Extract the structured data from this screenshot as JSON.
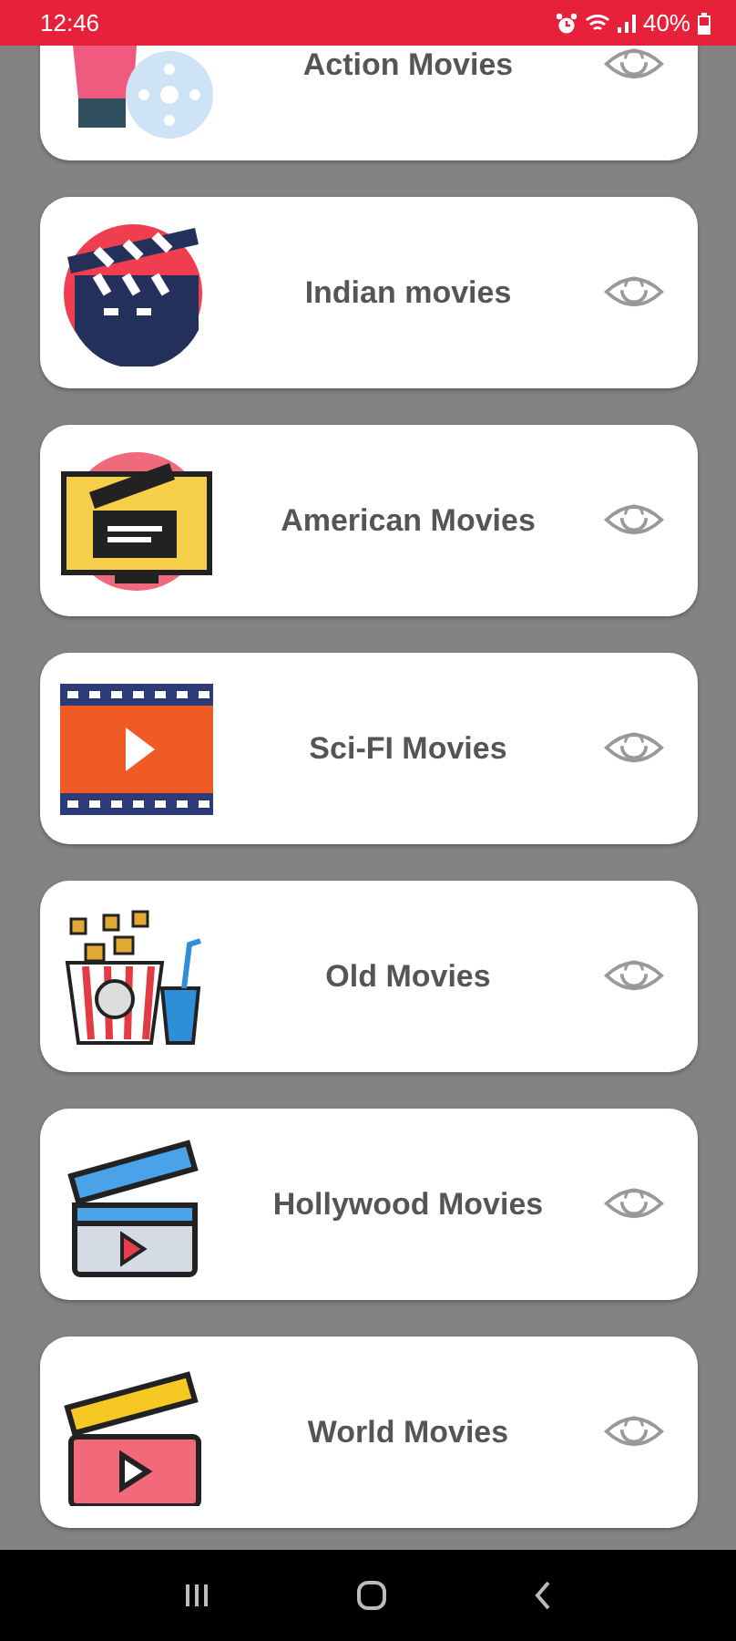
{
  "status_bar": {
    "time": "12:46",
    "battery": "40%"
  },
  "categories": [
    {
      "title": "Action Movies"
    },
    {
      "title": "Indian movies"
    },
    {
      "title": "American Movies"
    },
    {
      "title": "Sci-FI Movies"
    },
    {
      "title": "Old Movies"
    },
    {
      "title": "Hollywood Movies"
    },
    {
      "title": "World Movies"
    }
  ]
}
